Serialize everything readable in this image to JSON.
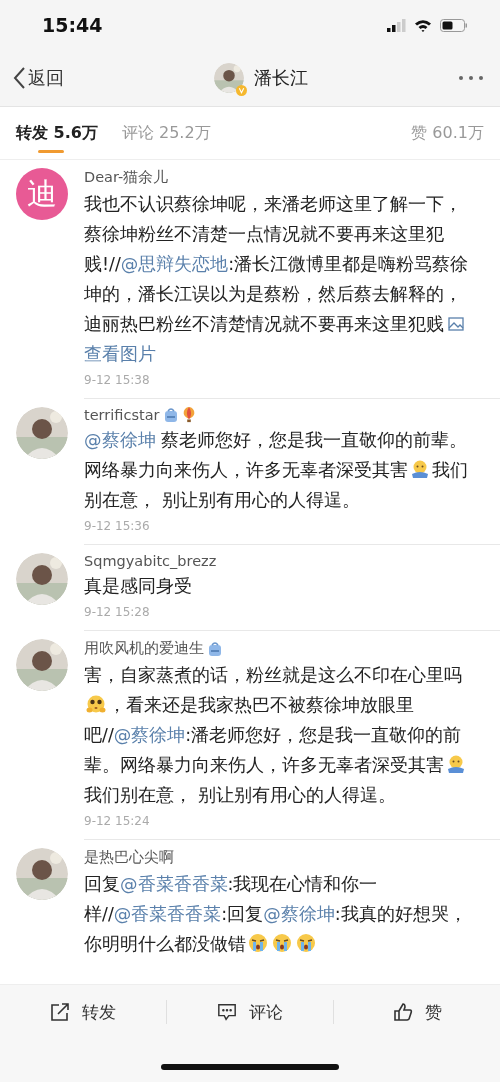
{
  "status_bar": {
    "time": "15:44"
  },
  "nav": {
    "back": "返回",
    "title": "潘长江",
    "verified": true
  },
  "tabs": [
    {
      "label": "转发 5.6万",
      "selected": true
    },
    {
      "label": "评论 25.2万",
      "selected": false
    },
    {
      "label": "赞 60.1万",
      "selected": false
    }
  ],
  "comments": [
    {
      "avatar": {
        "kind": "glyph",
        "text": "迪"
      },
      "name": "Dear-猫余儿",
      "body": [
        {
          "kind": "text",
          "text": "我也不认识蔡徐坤呢，来潘老师这里了解一下，蔡徐坤粉丝不清楚一点情况就不要再来这里犯贱!//"
        },
        {
          "kind": "mention",
          "text": "@思辩失恋地"
        },
        {
          "kind": "text",
          "text": ":潘长江微博里都是嗨粉骂蔡徐坤的，潘长江误以为是蔡粉，然后蔡去解释的，迪丽热巴粉丝不清楚情况就不要再来这里犯贱"
        },
        {
          "kind": "image_link",
          "text": "查看图片"
        }
      ],
      "time": "9-12 15:38"
    },
    {
      "avatar": {
        "kind": "picture"
      },
      "name": "terrificstar",
      "badges": [
        {
          "kind": "backpack"
        },
        {
          "kind": "balloon"
        }
      ],
      "body": [
        {
          "kind": "mention",
          "text": "@蔡徐坤"
        },
        {
          "kind": "text",
          "text": " 蔡老师您好，您是我一直敬仰的前辈。网络暴力向来伤人，许多无辜者深受其害"
        },
        {
          "kind": "hug_emoji"
        },
        {
          "kind": "text",
          "text": "我们别在意， 别让别有用心的人得逞。"
        }
      ],
      "time": "9-12 15:36"
    },
    {
      "avatar": {
        "kind": "picture"
      },
      "name": "Sqmgyabitc_brezz",
      "body": [
        {
          "kind": "text",
          "text": "真是感同身受"
        }
      ],
      "time": "9-12 15:28"
    },
    {
      "avatar": {
        "kind": "picture"
      },
      "name": "用吹风机的爱迪生",
      "badges": [
        {
          "kind": "backpack"
        }
      ],
      "body": [
        {
          "kind": "text",
          "text": "害，自家蒸煮的话，粉丝就是这么不印在心里吗"
        },
        {
          "kind": "pleading_emoji"
        },
        {
          "kind": "text",
          "text": "，看来还是我家热巴不被蔡徐坤放眼里吧//"
        },
        {
          "kind": "mention",
          "text": "@蔡徐坤"
        },
        {
          "kind": "text",
          "text": ":潘老师您好，您是我一直敬仰的前辈。网络暴力向来伤人，许多无辜者深受其害"
        },
        {
          "kind": "hug_emoji"
        },
        {
          "kind": "text",
          "text": "我们别在意， 别让别有用心的人得逞。"
        }
      ],
      "time": "9-12 15:24"
    },
    {
      "avatar": {
        "kind": "picture"
      },
      "name": "是热巴心尖啊",
      "body": [
        {
          "kind": "text",
          "text": "回复"
        },
        {
          "kind": "mention",
          "text": "@香菜香香菜"
        },
        {
          "kind": "text",
          "text": ":我现在心情和你一样//"
        },
        {
          "kind": "mention",
          "text": "@香菜香香菜"
        },
        {
          "kind": "text",
          "text": ":回复"
        },
        {
          "kind": "mention",
          "text": "@蔡徐坤"
        },
        {
          "kind": "text",
          "text": ":我真的好想哭，你明明什么都没做错"
        },
        {
          "kind": "crying_emoji"
        },
        {
          "kind": "crying_emoji"
        },
        {
          "kind": "crying_emoji"
        }
      ]
    }
  ],
  "actions": [
    {
      "kind": "repost",
      "label": "转发"
    },
    {
      "kind": "comment",
      "label": "评论"
    },
    {
      "kind": "like",
      "label": "赞"
    }
  ]
}
